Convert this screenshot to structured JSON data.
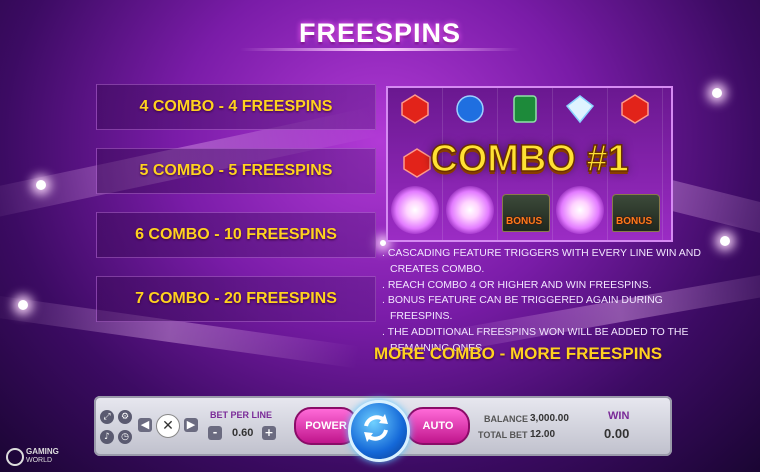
{
  "title": "FREESPINS",
  "combos": [
    {
      "label": "4 COMBO - 4 FREESPINS"
    },
    {
      "label": "5 COMBO - 5 FREESPINS"
    },
    {
      "label": "6 COMBO - 10 FREESPINS"
    },
    {
      "label": "7 COMBO - 20 FREESPINS"
    }
  ],
  "preview": {
    "combo_text": "COMBO #1",
    "bonus_symbol_text": "BONUS"
  },
  "notes": [
    "Cascading feature triggers with every line win and creates combo.",
    "Reach combo 4 or higher and win freespins.",
    "Bonus feature can be triggered again during freespins.",
    "The additional freespins won will be added to the remaining ones."
  ],
  "tagline": "MORE COMBO - MORE FREESPINS",
  "bottom_bar": {
    "bet_per_line_label": "BET PER LINE",
    "bet_value": "0.60",
    "minus": "-",
    "plus": "+",
    "power_label": "POWER",
    "auto_label": "AUTO",
    "balance_label": "BALANCE",
    "balance_value": "3,000.00",
    "total_bet_label": "TOTAL BET",
    "total_bet_value": "12.00",
    "win_label": "WIN",
    "win_value": "0.00",
    "brand_line1": "GAMING",
    "brand_line2": "WORLD"
  },
  "colors": {
    "accent": "#ffd21f",
    "background": "#7a1ca8",
    "power_button": "#e0389c",
    "spin_button": "#1468d8"
  }
}
